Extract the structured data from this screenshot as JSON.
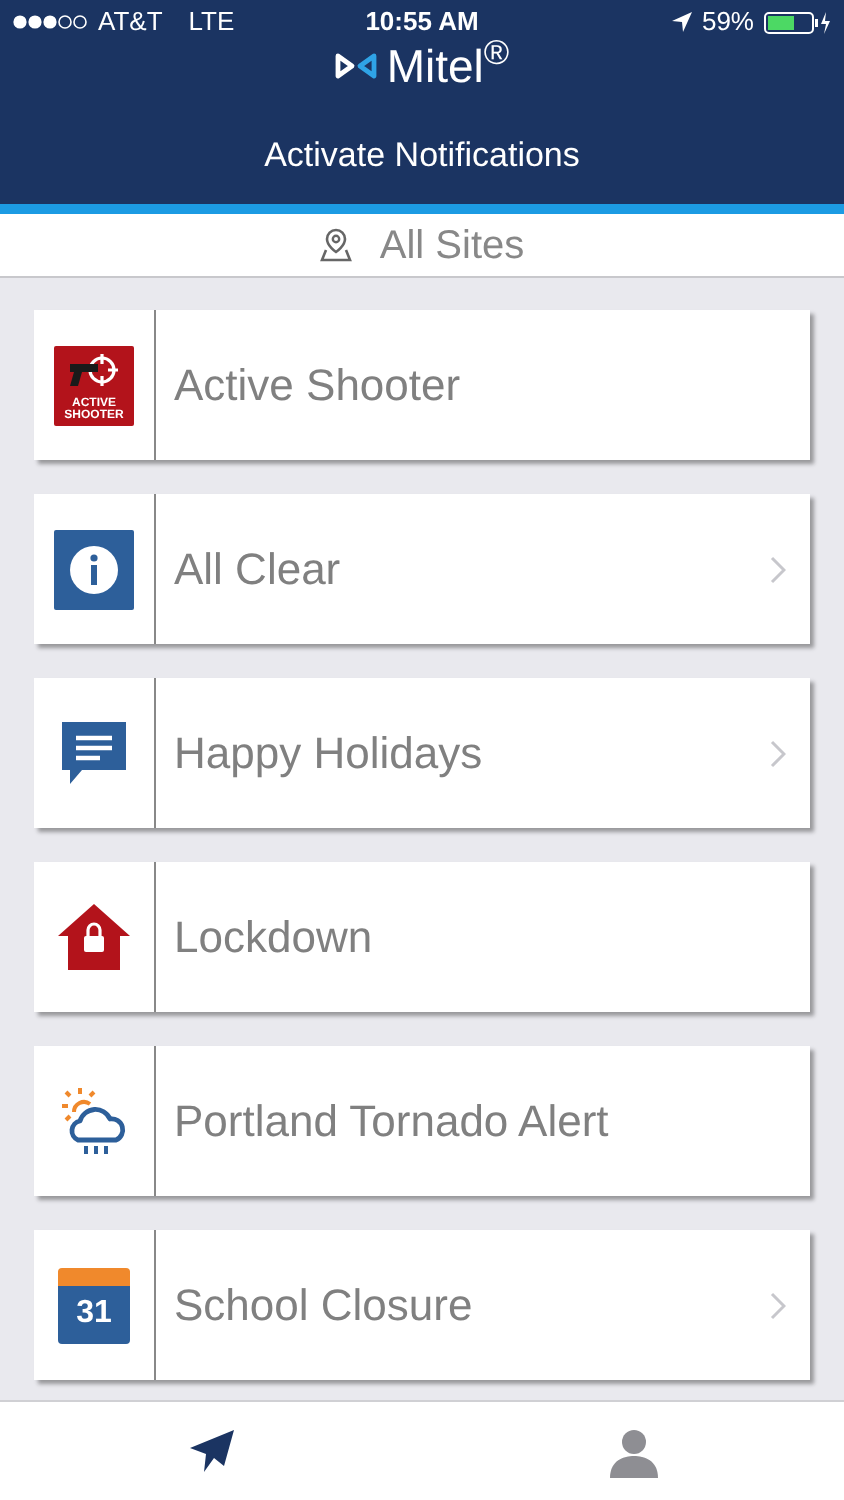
{
  "status_bar": {
    "carrier": "AT&T",
    "network": "LTE",
    "time": "10:55 AM",
    "battery": "59%"
  },
  "header": {
    "logo": "Mitel$^{®}$",
    "title": "Activate Notifications"
  },
  "site_filter": {
    "label": "All Sites"
  },
  "notifications": [
    {
      "kind": "shooter",
      "label": "Active Shooter",
      "icon_text": "ACTIVE SHOOTER",
      "chevron": false
    },
    {
      "kind": "info",
      "label": "All Clear",
      "chevron": true
    },
    {
      "kind": "message",
      "label": "Happy Holidays",
      "chevron": true
    },
    {
      "kind": "lockdown",
      "label": "Lockdown",
      "chevron": false
    },
    {
      "kind": "weather",
      "label": "Portland Tornado Alert",
      "chevron": false
    },
    {
      "kind": "calendar",
      "label": "School Closure",
      "icon_text": "31",
      "chevron": true
    }
  ],
  "tab_bar": [
    {
      "kind": "send",
      "selected": true
    },
    {
      "kind": "profile",
      "selected": false
    }
  ]
}
